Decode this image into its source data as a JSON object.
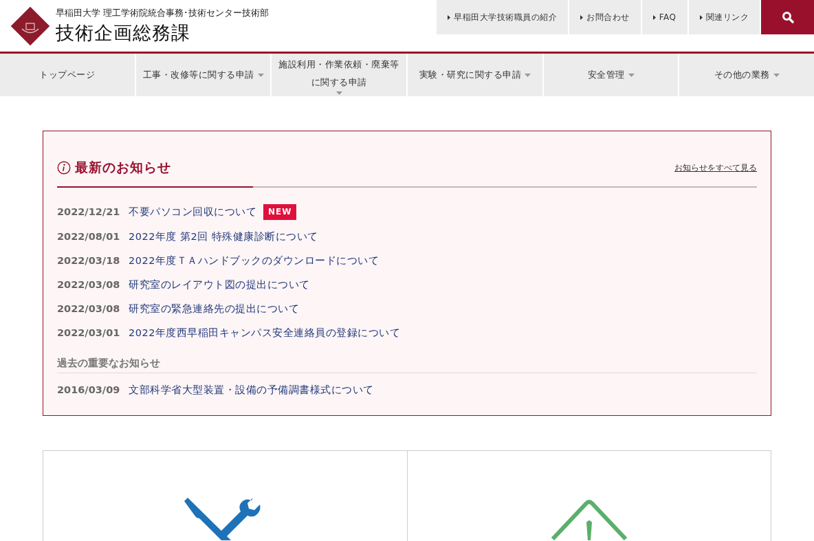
{
  "header": {
    "subtitle": "早稲田大学 理工学術院統合事務･技術センター技術部",
    "title": "技術企画総務課"
  },
  "utility_links": [
    {
      "label": "早稲田大学技術職員の紹介"
    },
    {
      "label": "お問合わせ"
    },
    {
      "label": "FAQ"
    },
    {
      "label": "関連リンク"
    }
  ],
  "nav": [
    {
      "label": "トップページ",
      "dropdown": false
    },
    {
      "label": "工事・改修等に関する申請",
      "dropdown": true
    },
    {
      "label": "施設利用・作業依頼・廃棄等に関する申請",
      "dropdown": true
    },
    {
      "label": "実験・研究に関する申請",
      "dropdown": true
    },
    {
      "label": "安全管理",
      "dropdown": true
    },
    {
      "label": "その他の業務",
      "dropdown": true
    }
  ],
  "news": {
    "title": "最新のお知らせ",
    "all_link": "お知らせをすべて見る",
    "items": [
      {
        "date": "2022/12/21",
        "title": "不要パソコン回収について",
        "badge": "NEW"
      },
      {
        "date": "2022/08/01",
        "title": "2022年度 第2回 特殊健康診断について"
      },
      {
        "date": "2022/03/18",
        "title": "2022年度ＴＡハンドブックのダウンロードについて"
      },
      {
        "date": "2022/03/08",
        "title": "研究室のレイアウト図の提出について"
      },
      {
        "date": "2022/03/08",
        "title": "研究室の緊急連絡先の提出について"
      },
      {
        "date": "2022/03/01",
        "title": "2022年度西早稲田キャンパス安全連絡員の登録について"
      }
    ],
    "past_heading": "過去の重要なお知らせ",
    "past_items": [
      {
        "date": "2016/03/09",
        "title": "文部科学省大型装置・設備の予備調書様式について"
      }
    ]
  },
  "cards": [
    {
      "kind": "tools"
    },
    {
      "kind": "warning"
    }
  ]
}
